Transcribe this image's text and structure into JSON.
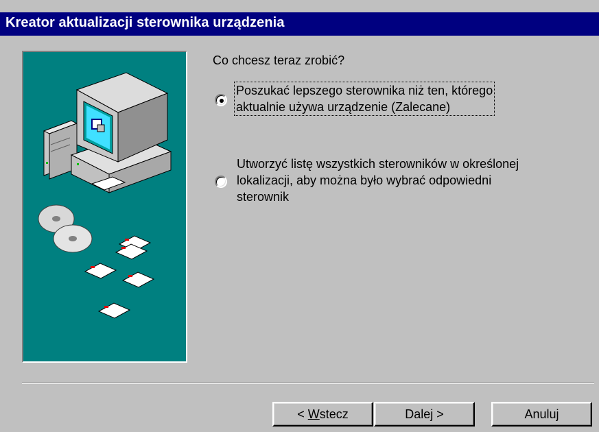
{
  "window": {
    "title": "Kreator aktualizacji sterownika urządzenia"
  },
  "main": {
    "question": "Co chcesz teraz zrobić?",
    "options": [
      {
        "line1": "Poszukać lepszego sterownika niż ten, którego",
        "line2": "aktualnie używa urządzenie (Zalecane)",
        "selected": true
      },
      {
        "line1": "Utworzyć listę wszystkich sterowników w określonej",
        "line2": "lokalizacji, aby można było wybrać odpowiedni",
        "line3": "sterownik",
        "selected": false
      }
    ]
  },
  "buttons": {
    "back_prefix": "< ",
    "back_accel": "W",
    "back_rest": "stecz",
    "next": "Dalej >",
    "cancel": "Anuluj"
  },
  "colors": {
    "titlebar": "#000080",
    "panel": "#008080",
    "face": "#c0c0c0"
  }
}
